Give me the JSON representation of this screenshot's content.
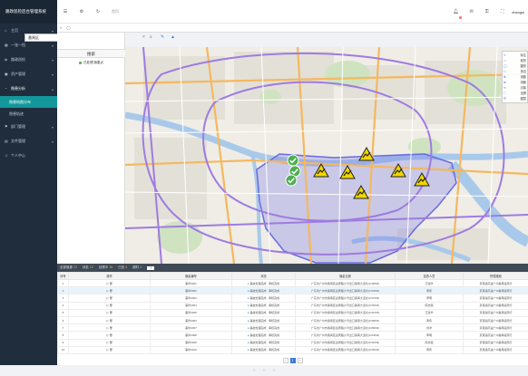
{
  "app": {
    "title": "路政巡检后台管理系统"
  },
  "sidebar": {
    "items": [
      {
        "label": "主页",
        "icon": "home-icon",
        "arrow": "▾"
      },
      {
        "label": "一张一档",
        "icon": "grid-icon",
        "arrow": "▾"
      },
      {
        "label": "路政巡检",
        "icon": "road-icon",
        "arrow": "▾"
      },
      {
        "label": "资产管理",
        "icon": "box-icon",
        "arrow": "▾"
      },
      {
        "label": "隐患分析",
        "icon": "chart-icon",
        "arrow": "▴"
      }
    ],
    "sub_items": [
      {
        "label": "隐患地图分布"
      },
      {
        "label": "隐患轨迹"
      }
    ],
    "items_after": [
      {
        "label": "部门管理",
        "icon": "org-icon",
        "arrow": "▾"
      },
      {
        "label": "文件管理",
        "icon": "file-icon",
        "arrow": "▾"
      },
      {
        "label": "个人中心",
        "icon": "user-icon",
        "arrow": ""
      }
    ]
  },
  "topbar": {
    "crumb": "首页",
    "user": "zhangsi"
  },
  "search": {
    "value": "番禺区",
    "placeholder": "请输入区域"
  },
  "left_panel": {
    "header": "搜索",
    "rows": [
      {
        "label": "已处理  隐患点"
      }
    ]
  },
  "map_tools": [
    {
      "icon": "✎",
      "label": "标注"
    },
    {
      "icon": "▭",
      "label": "矩形"
    },
    {
      "icon": "◯",
      "label": "圆形"
    },
    {
      "icon": "⬠",
      "label": "多边"
    },
    {
      "icon": "✥",
      "label": "测距"
    },
    {
      "icon": "⊞",
      "label": "测面"
    },
    {
      "icon": "⟲",
      "label": "清除"
    },
    {
      "icon": "⛶",
      "label": "全屏"
    },
    {
      "icon": "☰",
      "label": "图层"
    }
  ],
  "table": {
    "tabs": [
      {
        "label": "全部隐患",
        "count": "22"
      },
      {
        "label": "待处",
        "count": "12"
      },
      {
        "label": "处理中",
        "count": "16"
      },
      {
        "label": "已处",
        "count": "4"
      },
      {
        "label": "超时",
        "count": "1"
      }
    ],
    "columns": [
      "序号",
      "操作",
      "隐患编号",
      "状态",
      "隐患位置",
      "巡查人员",
      "所属路段"
    ],
    "rows": [
      {
        "no": "1",
        "id": "事件0001",
        "status": "事故处理完成 · 审核完成",
        "loc": "广东省广州市番禺区迎宾路沙湾出口番禺大道北(0.98KM)",
        "person": "王建华",
        "road": "京港澳高速广州番禺段南行"
      },
      {
        "no": "2",
        "id": "事件0002",
        "status": "事故处理完成 · 审核完成",
        "loc": "广东省广州市番禺区迎宾路沙湾出口番禺大道北(0.93KM)",
        "person": "黄伟",
        "road": "京港澳高速广州番禺段南行"
      },
      {
        "no": "3",
        "id": "事件0003",
        "status": "事故处理完成 · 审核完成",
        "loc": "广东省广州市番禺区迎宾路沙湾出口番禺大道北(0.97KM)",
        "person": "李明",
        "road": "京港澳高速广州番禺段南行"
      },
      {
        "no": "4",
        "id": "事件0004",
        "status": "事故处理完成 · 审核完成",
        "loc": "广东省广州市番禺区迎宾路沙湾出口番禺大道北(0.96KM)",
        "person": "陈志强",
        "road": "京港澳高速广州番禺段南行"
      },
      {
        "no": "5",
        "id": "事件0005",
        "status": "事故处理完成 · 审核完成",
        "loc": "广东省广州市番禺区迎宾路沙湾出口番禺大道北(0.91KM)",
        "person": "王建华",
        "road": "京港澳高速广州番禺段南行"
      },
      {
        "no": "6",
        "id": "事件0006",
        "status": "事故处理完成 · 审核完成",
        "loc": "广东省广州市番禺区迎宾路沙湾出口番禺大道北(0.98KM)",
        "person": "黄伟",
        "road": "京港澳高速广州番禺段南行"
      },
      {
        "no": "7",
        "id": "事件0007",
        "status": "事故处理完成 · 审核完成",
        "loc": "广东省广州市番禺区迎宾路沙湾出口番禺大道北(0.88KM)",
        "person": "刘洋",
        "road": "京港澳高速广州番禺段南行"
      },
      {
        "no": "8",
        "id": "事件0008",
        "status": "事故处理完成 · 审核完成",
        "loc": "广东省广州市番禺区迎宾路沙湾出口番禺大道北(0.94KM)",
        "person": "李明",
        "road": "京港澳高速广州番禺段南行"
      },
      {
        "no": "9",
        "id": "事件0009",
        "status": "事故处理完成 · 审核完成",
        "loc": "广东省广州市番禺区迎宾路沙湾出口番禺大道北(0.92KM)",
        "person": "陈志强",
        "road": "京港澳高速广州番禺段南行"
      },
      {
        "no": "10",
        "id": "事件0010",
        "status": "事故处理完成 · 审核完成",
        "loc": "广东省广州市番禺区迎宾路沙湾出口番禺大道北(0.95KM)",
        "person": "黄伟",
        "road": "京港澳高速广州番禺段南行"
      }
    ],
    "pager": [
      "‹",
      "1",
      "›"
    ]
  },
  "colors": {
    "accent": "#13979b",
    "sidebar": "#1f2d3d",
    "warning": "#f2d600",
    "check": "#4caf50"
  }
}
